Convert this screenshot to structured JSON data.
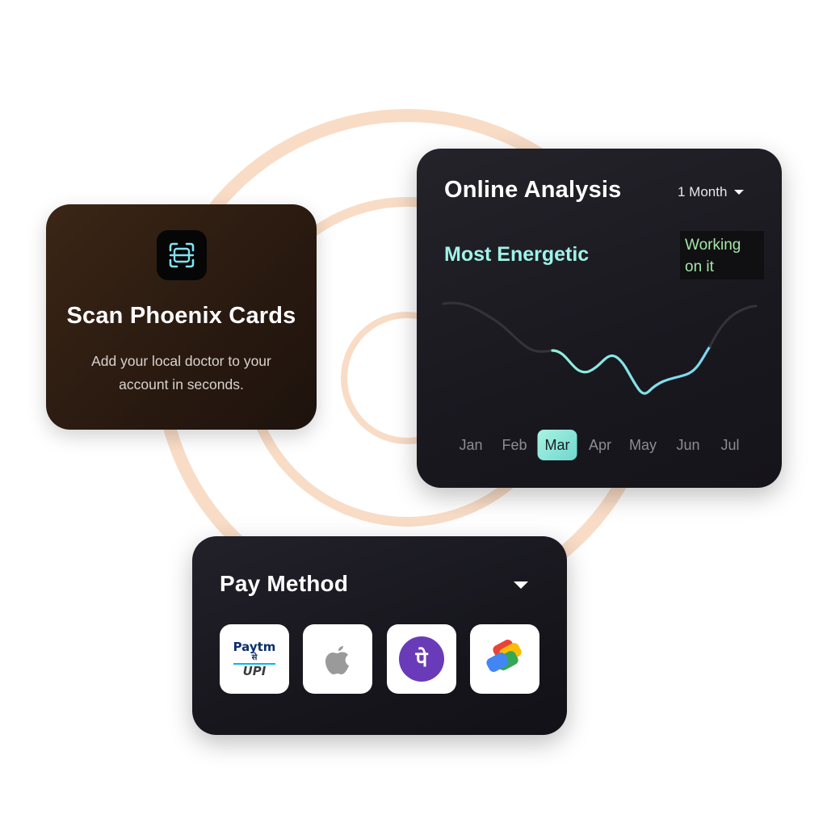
{
  "colors": {
    "ring": "#f8dcc6",
    "accent_mint": "#9ff3e8",
    "status_green": "#a5e6a8",
    "scan_card_bg": "#2c1c12",
    "dark_card_bg": "#1c1b22"
  },
  "scan_card": {
    "icon": "scan-card-icon",
    "title": "Scan Phoenix Cards",
    "description_line1": "Add your local doctor to your",
    "description_line2": "account in seconds."
  },
  "analysis_card": {
    "title": "Online Analysis",
    "period": "1 Month",
    "highlight": "Most Energetic",
    "status_line1": "Working",
    "status_line2": "on it",
    "months": [
      "Jan",
      "Feb",
      "Mar",
      "Apr",
      "May",
      "Jun",
      "Jul"
    ],
    "selected_month": "Mar"
  },
  "pay_card": {
    "title": "Pay Method",
    "methods": [
      {
        "name": "Paytm UPI",
        "icon": "paytm-upi-icon",
        "text_top": "Paytm",
        "text_mid": "से",
        "text_bottom": "UPI"
      },
      {
        "name": "Apple Pay",
        "icon": "apple-icon"
      },
      {
        "name": "PhonePe",
        "icon": "phonepe-icon",
        "glyph": "पे"
      },
      {
        "name": "Google Pay",
        "icon": "google-pay-icon"
      }
    ]
  }
}
